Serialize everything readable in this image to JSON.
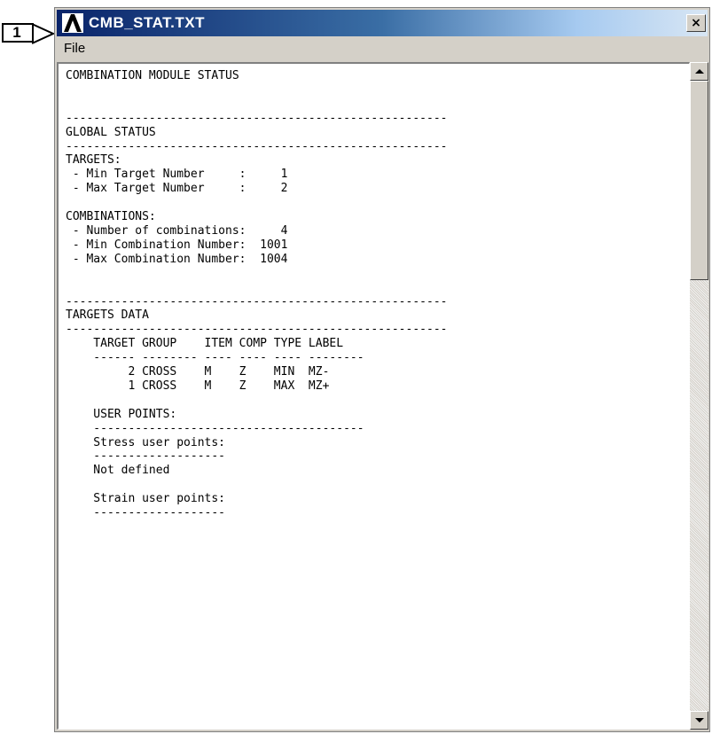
{
  "callout": {
    "number": "1"
  },
  "window": {
    "title": "CMB_STAT.TXT",
    "close_label": "×"
  },
  "menu": {
    "items": [
      {
        "label": "File"
      }
    ]
  },
  "document": {
    "lines": [
      "COMBINATION MODULE STATUS",
      "",
      "",
      "-------------------------------------------------------",
      "GLOBAL STATUS",
      "-------------------------------------------------------",
      "TARGETS:",
      " - Min Target Number     :     1",
      " - Max Target Number     :     2",
      "",
      "COMBINATIONS:",
      " - Number of combinations:     4",
      " - Min Combination Number:  1001",
      " - Max Combination Number:  1004",
      "",
      "",
      "-------------------------------------------------------",
      "TARGETS DATA",
      "-------------------------------------------------------",
      "    TARGET GROUP    ITEM COMP TYPE LABEL",
      "    ------ -------- ---- ---- ---- --------",
      "         2 CROSS    M    Z    MIN  MZ-",
      "         1 CROSS    M    Z    MAX  MZ+",
      "",
      "    USER POINTS:",
      "    ---------------------------------------",
      "    Stress user points:",
      "    -------------------",
      "    Not defined",
      "",
      "    Strain user points:",
      "    -------------------"
    ]
  }
}
